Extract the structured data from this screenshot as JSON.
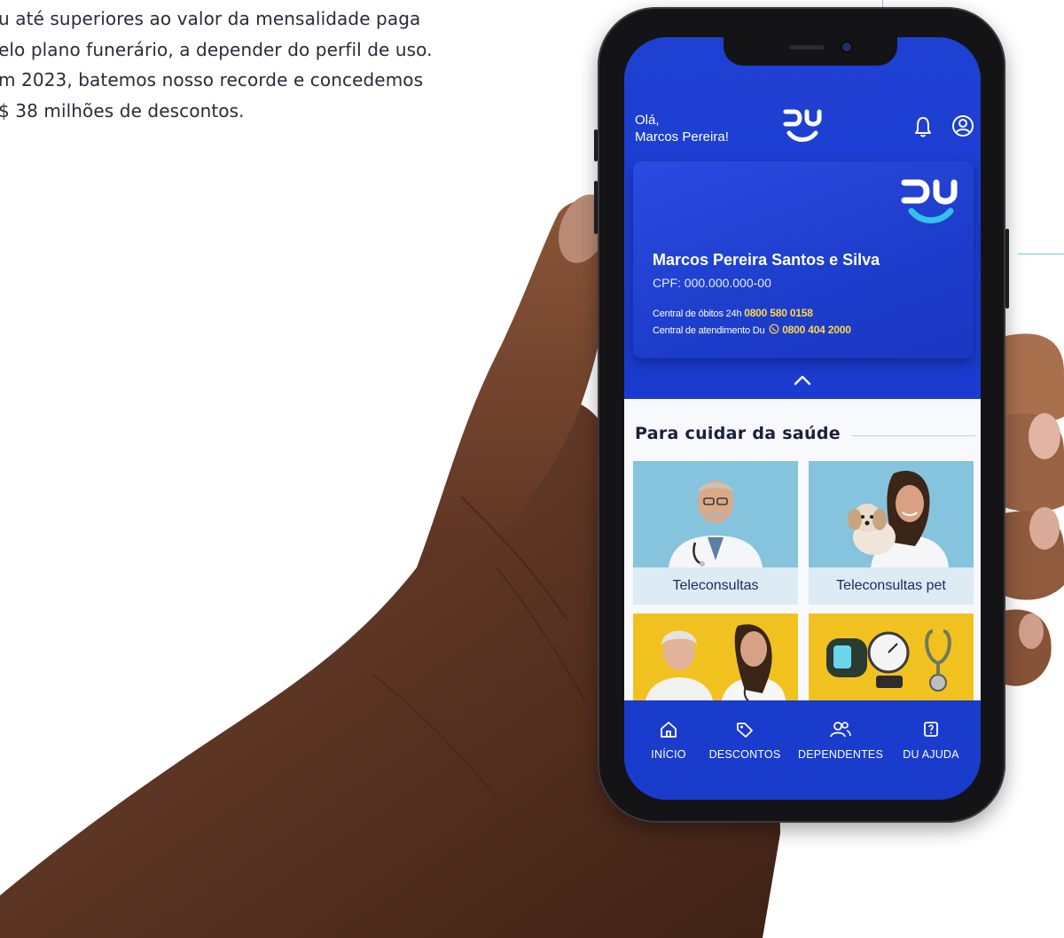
{
  "page": {
    "paragraph_lines": [
      "u até superiores ao valor da mensalidade paga",
      "elo plano funerário, a depender do perfil de uso.",
      "m 2023, batemos nosso recorde e concedemos",
      "$ 38 milhões de descontos."
    ]
  },
  "app": {
    "greeting_line1": "Olá,",
    "greeting_line2": "Marcos Pereira!",
    "logo_text": "DU",
    "card": {
      "name": "Marcos Pereira Santos e Silva",
      "cpf": "CPF: 000.000.000-00",
      "obitos_label": "Central de óbitos 24h",
      "obitos_phone": "0800 580 0158",
      "atendimento_label": "Central de atendimento Du",
      "atendimento_phone": "0800 404 2000"
    },
    "section_title": "Para cuidar da saúde",
    "tiles": [
      {
        "label": "Teleconsultas"
      },
      {
        "label": "Teleconsultas pet"
      },
      {
        "label": ""
      },
      {
        "label": ""
      }
    ],
    "nav": [
      {
        "label": "INÍCIO",
        "icon": "home-icon"
      },
      {
        "label": "DESCONTOS",
        "icon": "tag-icon"
      },
      {
        "label": "DEPENDENTES",
        "icon": "users-icon"
      },
      {
        "label": "DU AJUDA",
        "icon": "help-icon"
      }
    ],
    "colors": {
      "primary_blue": "#1b3bd0",
      "accent_yellow": "#ffd84a",
      "logo_cyan": "#33c3e8"
    }
  }
}
